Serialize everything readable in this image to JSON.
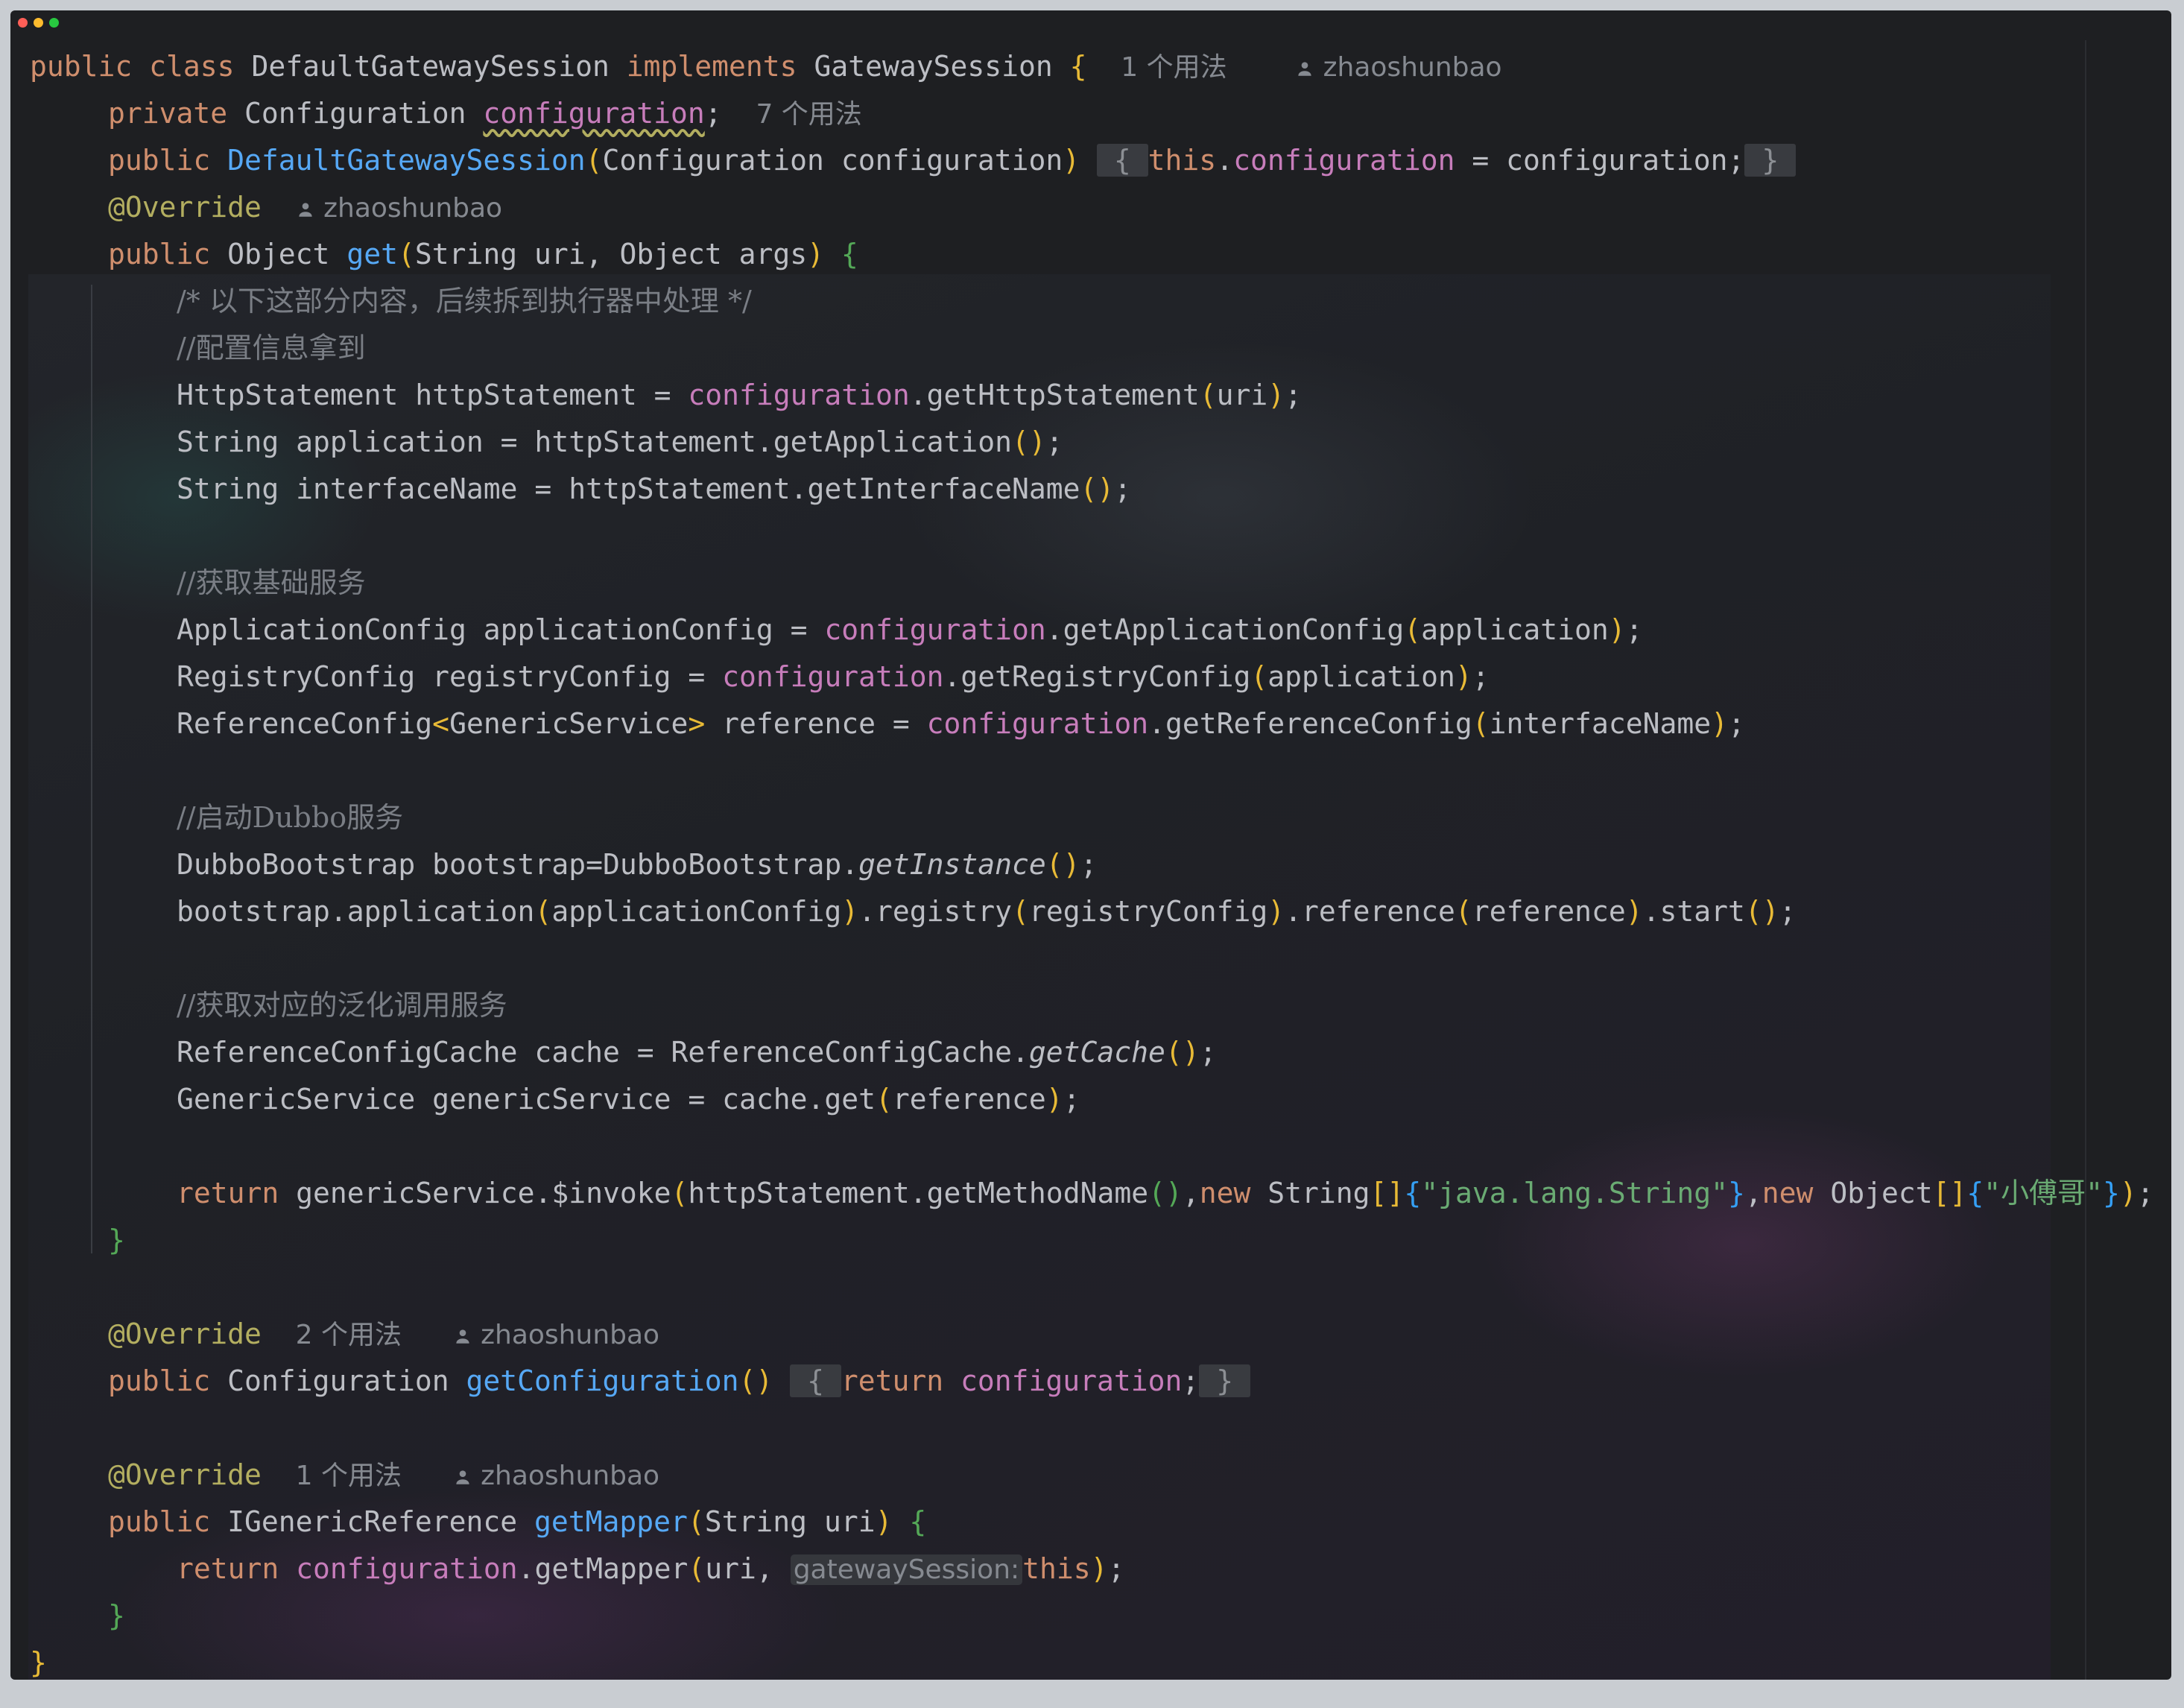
{
  "window": {
    "traffic_lights": {
      "close": "#ff5f57",
      "minimize": "#febc2e",
      "maximize": "#28c840"
    }
  },
  "editor": {
    "colors": {
      "background": "#1e1f22",
      "keyword": "#cf8e6d",
      "function": "#56a8f5",
      "field": "#c77dbb",
      "annotation": "#b3ae60",
      "comment": "#7a7e85",
      "string": "#6aab73",
      "text": "#bcbec4"
    },
    "language": "java",
    "class_hint_usages": "1 个用法",
    "author": "zhaoshunbao",
    "field_hint_usages": "7 个用法",
    "get_configuration_usages": "2 个用法",
    "get_mapper_usages": "1 个用法",
    "comment_1": "/* 以下这部分内容，后续拆到执行器中处理 */",
    "comment_2": "//配置信息拿到",
    "comment_3": "//获取基础服务",
    "comment_4": "//启动Dubbo服务",
    "comment_5": "//获取对应的泛化调用服务",
    "string_1": "\"java.lang.String\"",
    "string_2": "\"小傅哥\"",
    "inlay_param": "gatewaySession:",
    "t": {
      "public": "public",
      "class": "class",
      "implements": "implements",
      "private": "private",
      "this": "this",
      "return": "return",
      "new": "new",
      "override": "@Override",
      "DefaultGatewaySession": "DefaultGatewaySession",
      "GatewaySession": "GatewaySession",
      "Configuration": "Configuration",
      "configuration": "configuration",
      "Object": "Object",
      "get": "get",
      "String": "String",
      "uri": "uri",
      "args": "args",
      "getConfiguration": "getConfiguration",
      "IGenericReference": "IGenericReference",
      "getMapper": "getMapper"
    },
    "lines": {
      "l8": "HttpStatement httpStatement = ",
      "l8b": ".getHttpStatement",
      "l9": "String application = httpStatement.getApplication",
      "l10": "String interfaceName = httpStatement.getInterfaceName",
      "l13a": "ApplicationConfig applicationConfig = ",
      "l13b": ".getApplicationConfig",
      "l13c": "application",
      "l14a": "RegistryConfig registryConfig = ",
      "l14b": ".getRegistryConfig",
      "l15a": "ReferenceConfig",
      "l15b": "GenericService",
      "l15c": " reference = ",
      "l15d": ".getReferenceConfig",
      "l15e": "interfaceName",
      "l18a": "DubboBootstrap bootstrap=DubboBootstrap.",
      "l18b": "getInstance",
      "l19a": "bootstrap.application",
      "l19b": "applicationConfig",
      "l19c": ".registry",
      "l19d": "registryConfig",
      "l19e": ".reference",
      "l19f": "reference",
      "l19g": ".start",
      "l22a": "ReferenceConfigCache cache = ReferenceConfigCache.",
      "l22b": "getCache",
      "l23a": "GenericService genericService = cache.get",
      "l23b": "reference",
      "l25a": " genericService.$invoke",
      "l25b": "httpStatement.getMethodName",
      "l25c": " String",
      "l25d": " Object"
    }
  }
}
